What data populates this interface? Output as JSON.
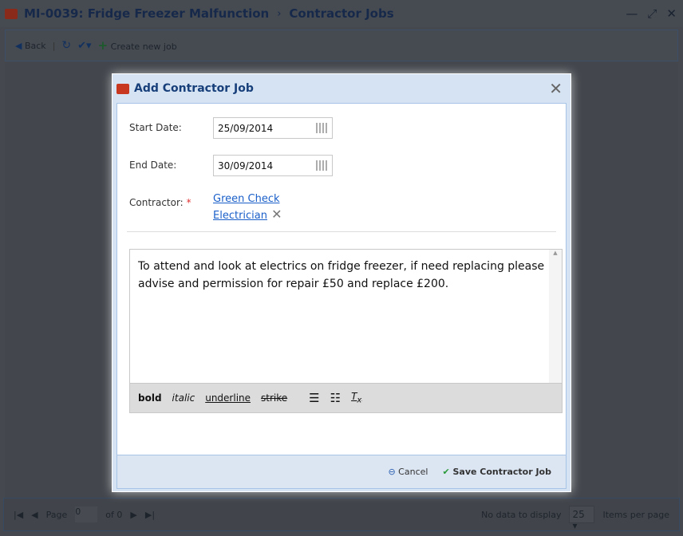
{
  "window": {
    "title": "MI-0039: Fridge Freezer Malfunction",
    "separator": "›",
    "subtitle": "Contractor Jobs"
  },
  "toolbar": {
    "back": "Back",
    "create": "Create new job"
  },
  "pager": {
    "page_label": "Page",
    "page_value": "0",
    "of": "of 0",
    "no_data": "No data to display",
    "page_size": "25",
    "items_per_page": "Items per page"
  },
  "dialog": {
    "title": "Add Contractor Job",
    "start_label": "Start Date:",
    "start_value": "25/09/2014",
    "end_label": "End Date:",
    "end_value": "30/09/2014",
    "contractor_label": "Contractor:",
    "required_mark": "*",
    "contractor_name": "Green Check",
    "contractor_trade": "Electrician",
    "notes": "To attend and look at electrics on fridge freezer, if need replacing please advise and permission for repair £50 and replace £200.",
    "tools": {
      "bold": "bold",
      "italic": "italic",
      "underline": "underline",
      "strike": "strike"
    },
    "cancel": "Cancel",
    "save": "Save Contractor Job"
  }
}
